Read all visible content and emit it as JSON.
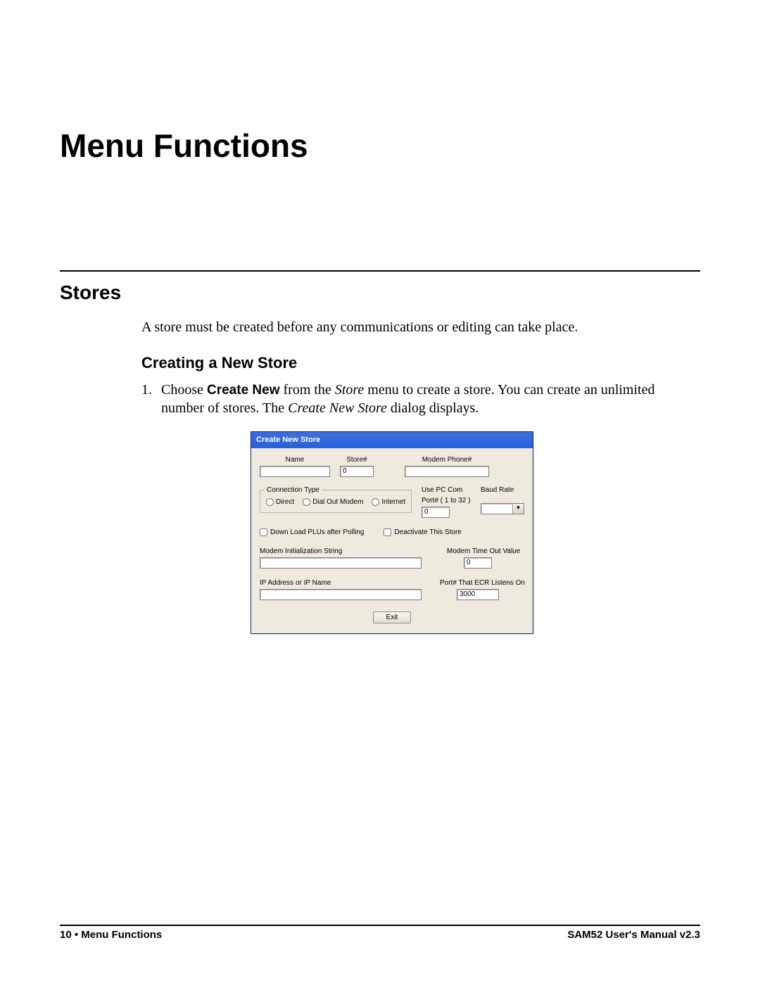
{
  "page": {
    "h1": "Menu Functions",
    "h2": "Stores",
    "intro": "A store must be created before any communications or editing can take place.",
    "h3": "Creating a New Store",
    "step1_num": "1.",
    "step1_a": "Choose ",
    "step1_b": "Create New",
    "step1_c": " from the ",
    "step1_d": "Store",
    "step1_e": " menu to create a store.  You can create an unlimited number of stores.  The ",
    "step1_f": "Create New Store",
    "step1_g": " dialog displays."
  },
  "dialog": {
    "title": "Create New Store",
    "name_lbl": "Name",
    "name_val": "",
    "storeno_lbl": "Store#",
    "storeno_val": "0",
    "modemphone_lbl": "Modem Phone#",
    "modemphone_val": "",
    "conn_legend": "Connection Type",
    "conn_direct": "Direct",
    "conn_dial": "Dial Out Modem",
    "conn_internet": "Internet",
    "pccom_lbl1": "Use PC Com",
    "pccom_lbl2": "Port# ( 1  to 32 )",
    "pccom_val": "0",
    "baud_lbl": "Baud Rate",
    "baud_val": "",
    "chk_download": "Down Load PLUs after Polling",
    "chk_deact": "Deactivate This Store",
    "modeminit_lbl": "Modem Initialization String",
    "modeminit_val": "",
    "timeout_lbl": "Modem Time Out Value",
    "timeout_val": "0",
    "ip_lbl": "IP Address or IP Name",
    "ip_val": "",
    "ecrport_lbl": "Port# That ECR Listens On",
    "ecrport_val": "3000",
    "exit_btn": "Exit"
  },
  "footer": {
    "left_page": "10",
    "left_sep": "  •  ",
    "left_section": "Menu Functions",
    "right": "SAM52 User's Manual v2.3"
  }
}
